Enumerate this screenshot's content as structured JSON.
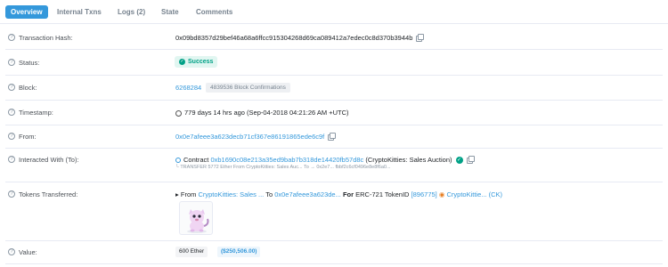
{
  "tabs": [
    {
      "label": "Overview"
    },
    {
      "label": "Internal Txns"
    },
    {
      "label": "Logs (2)"
    },
    {
      "label": "State"
    },
    {
      "label": "Comments"
    }
  ],
  "fields": {
    "tx_hash": {
      "label": "Transaction Hash:",
      "value": "0x09bd8357d29bef46a68a6ffcc915304268d69ca089412a7edec0c8d370b3944b"
    },
    "status": {
      "label": "Status:",
      "value": "Success"
    },
    "block": {
      "label": "Block:",
      "number": "6268284",
      "confirmations": "4839536 Block Confirmations"
    },
    "timestamp": {
      "label": "Timestamp:",
      "value": "779 days 14 hrs ago (Sep-04-2018 04:21:26 AM +UTC)"
    },
    "from": {
      "label": "From:",
      "value": "0x0e7afeee3a623decb71cf367e86191865ede6c9f"
    },
    "interacted": {
      "label": "Interacted With (To):",
      "prefix": "Contract",
      "address": "0xb1690c08e213a35ed9bab7b318de14420fb57d8c",
      "name": "(CryptoKitties: Sales Auction)",
      "transfer_line": "└ TRANSFER 5772 Ether From CryptoKitties: Sales Auc... To → 0x2e7... fbbf2c6cf0496e8e8f6a0..."
    },
    "tokens": {
      "label": "Tokens Transferred:",
      "from_label": "From",
      "from_value": "CryptoKitties: Sales ...",
      "to_label": "To",
      "to_value": "0x0e7afeee3a623de...",
      "for_label": "For",
      "token_type": "ERC-721 TokenID",
      "token_id": "[896775]",
      "token_name": "CryptoKittie... (CK)"
    },
    "value": {
      "label": "Value:",
      "ether": "600 Ether",
      "usd": "($250,506.00)"
    }
  },
  "colors": {
    "accent": "#3498db",
    "success": "#00a186",
    "muted": "#77838f"
  }
}
